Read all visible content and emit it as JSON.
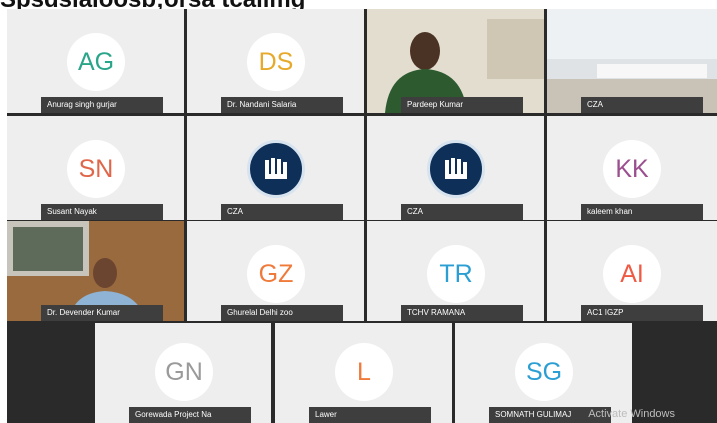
{
  "headline": "Spsdslaloosb;orsa  tcallmg",
  "participants": [
    {
      "name": "Anurag singh gurjar",
      "initials": "AG",
      "color": "#2aa58a"
    },
    {
      "name": "Dr. Nandani Salaria",
      "initials": "DS",
      "color": "#e6a92a"
    },
    {
      "name": "Pardeep Kumar",
      "type": "video"
    },
    {
      "name": "CZA",
      "type": "video"
    },
    {
      "name": "Susant Nayak",
      "initials": "SN",
      "color": "#e0664a"
    },
    {
      "name": "CZA",
      "type": "logo"
    },
    {
      "name": "CZA",
      "type": "logo"
    },
    {
      "name": "kaleem khan",
      "initials": "KK",
      "color": "#9b4f8f"
    },
    {
      "name": "Dr. Devender Kumar",
      "type": "video"
    },
    {
      "name": "Ghurelal Delhi zoo",
      "initials": "GZ",
      "color": "#f07a3a"
    },
    {
      "name": "TCHV RAMANA",
      "initials": "TR",
      "color": "#2b9fd3"
    },
    {
      "name": "AC1 IGZP",
      "initials": "AI",
      "color": "#ef5a44"
    },
    {
      "name": "Gorewada Project Na",
      "initials": "GN",
      "color": "#9a9a9a"
    },
    {
      "name": "Lawer",
      "initials": "L",
      "color": "#f07a3a"
    },
    {
      "name": "SOMNATH GULIMAJ",
      "initials": "SG",
      "color": "#2b9fd3"
    }
  ],
  "watermark": "Activate Windows"
}
